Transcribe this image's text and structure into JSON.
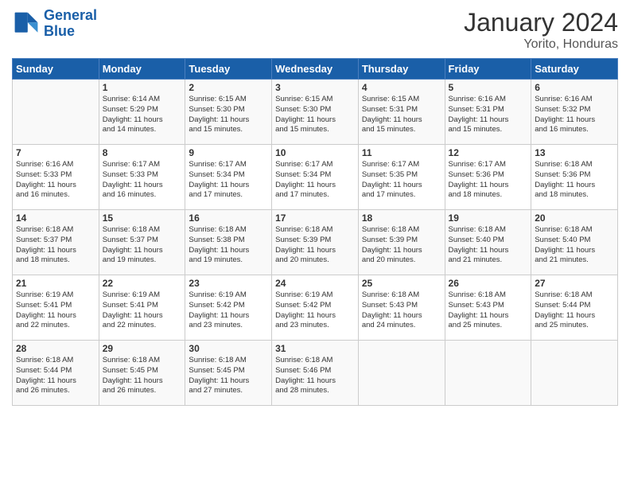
{
  "header": {
    "logo_line1": "General",
    "logo_line2": "Blue",
    "title": "January 2024",
    "subtitle": "Yorito, Honduras"
  },
  "weekdays": [
    "Sunday",
    "Monday",
    "Tuesday",
    "Wednesday",
    "Thursday",
    "Friday",
    "Saturday"
  ],
  "weeks": [
    [
      {
        "num": "",
        "info": ""
      },
      {
        "num": "1",
        "info": "Sunrise: 6:14 AM\nSunset: 5:29 PM\nDaylight: 11 hours\nand 14 minutes."
      },
      {
        "num": "2",
        "info": "Sunrise: 6:15 AM\nSunset: 5:30 PM\nDaylight: 11 hours\nand 15 minutes."
      },
      {
        "num": "3",
        "info": "Sunrise: 6:15 AM\nSunset: 5:30 PM\nDaylight: 11 hours\nand 15 minutes."
      },
      {
        "num": "4",
        "info": "Sunrise: 6:15 AM\nSunset: 5:31 PM\nDaylight: 11 hours\nand 15 minutes."
      },
      {
        "num": "5",
        "info": "Sunrise: 6:16 AM\nSunset: 5:31 PM\nDaylight: 11 hours\nand 15 minutes."
      },
      {
        "num": "6",
        "info": "Sunrise: 6:16 AM\nSunset: 5:32 PM\nDaylight: 11 hours\nand 16 minutes."
      }
    ],
    [
      {
        "num": "7",
        "info": "Sunrise: 6:16 AM\nSunset: 5:33 PM\nDaylight: 11 hours\nand 16 minutes."
      },
      {
        "num": "8",
        "info": "Sunrise: 6:17 AM\nSunset: 5:33 PM\nDaylight: 11 hours\nand 16 minutes."
      },
      {
        "num": "9",
        "info": "Sunrise: 6:17 AM\nSunset: 5:34 PM\nDaylight: 11 hours\nand 17 minutes."
      },
      {
        "num": "10",
        "info": "Sunrise: 6:17 AM\nSunset: 5:34 PM\nDaylight: 11 hours\nand 17 minutes."
      },
      {
        "num": "11",
        "info": "Sunrise: 6:17 AM\nSunset: 5:35 PM\nDaylight: 11 hours\nand 17 minutes."
      },
      {
        "num": "12",
        "info": "Sunrise: 6:17 AM\nSunset: 5:36 PM\nDaylight: 11 hours\nand 18 minutes."
      },
      {
        "num": "13",
        "info": "Sunrise: 6:18 AM\nSunset: 5:36 PM\nDaylight: 11 hours\nand 18 minutes."
      }
    ],
    [
      {
        "num": "14",
        "info": "Sunrise: 6:18 AM\nSunset: 5:37 PM\nDaylight: 11 hours\nand 18 minutes."
      },
      {
        "num": "15",
        "info": "Sunrise: 6:18 AM\nSunset: 5:37 PM\nDaylight: 11 hours\nand 19 minutes."
      },
      {
        "num": "16",
        "info": "Sunrise: 6:18 AM\nSunset: 5:38 PM\nDaylight: 11 hours\nand 19 minutes."
      },
      {
        "num": "17",
        "info": "Sunrise: 6:18 AM\nSunset: 5:39 PM\nDaylight: 11 hours\nand 20 minutes."
      },
      {
        "num": "18",
        "info": "Sunrise: 6:18 AM\nSunset: 5:39 PM\nDaylight: 11 hours\nand 20 minutes."
      },
      {
        "num": "19",
        "info": "Sunrise: 6:18 AM\nSunset: 5:40 PM\nDaylight: 11 hours\nand 21 minutes."
      },
      {
        "num": "20",
        "info": "Sunrise: 6:18 AM\nSunset: 5:40 PM\nDaylight: 11 hours\nand 21 minutes."
      }
    ],
    [
      {
        "num": "21",
        "info": "Sunrise: 6:19 AM\nSunset: 5:41 PM\nDaylight: 11 hours\nand 22 minutes."
      },
      {
        "num": "22",
        "info": "Sunrise: 6:19 AM\nSunset: 5:41 PM\nDaylight: 11 hours\nand 22 minutes."
      },
      {
        "num": "23",
        "info": "Sunrise: 6:19 AM\nSunset: 5:42 PM\nDaylight: 11 hours\nand 23 minutes."
      },
      {
        "num": "24",
        "info": "Sunrise: 6:19 AM\nSunset: 5:42 PM\nDaylight: 11 hours\nand 23 minutes."
      },
      {
        "num": "25",
        "info": "Sunrise: 6:18 AM\nSunset: 5:43 PM\nDaylight: 11 hours\nand 24 minutes."
      },
      {
        "num": "26",
        "info": "Sunrise: 6:18 AM\nSunset: 5:43 PM\nDaylight: 11 hours\nand 25 minutes."
      },
      {
        "num": "27",
        "info": "Sunrise: 6:18 AM\nSunset: 5:44 PM\nDaylight: 11 hours\nand 25 minutes."
      }
    ],
    [
      {
        "num": "28",
        "info": "Sunrise: 6:18 AM\nSunset: 5:44 PM\nDaylight: 11 hours\nand 26 minutes."
      },
      {
        "num": "29",
        "info": "Sunrise: 6:18 AM\nSunset: 5:45 PM\nDaylight: 11 hours\nand 26 minutes."
      },
      {
        "num": "30",
        "info": "Sunrise: 6:18 AM\nSunset: 5:45 PM\nDaylight: 11 hours\nand 27 minutes."
      },
      {
        "num": "31",
        "info": "Sunrise: 6:18 AM\nSunset: 5:46 PM\nDaylight: 11 hours\nand 28 minutes."
      },
      {
        "num": "",
        "info": ""
      },
      {
        "num": "",
        "info": ""
      },
      {
        "num": "",
        "info": ""
      }
    ]
  ]
}
